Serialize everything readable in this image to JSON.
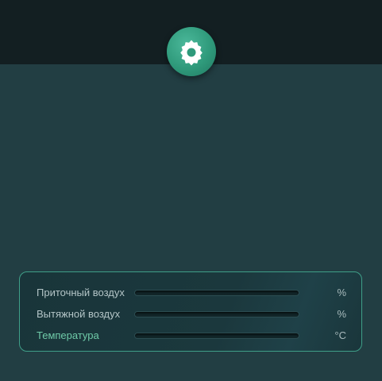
{
  "header": {
    "settings_icon": "gear-icon"
  },
  "panel": {
    "rows": [
      {
        "label": "Приточный воздух",
        "unit": "%",
        "level": 0
      },
      {
        "label": "Вытяжной воздух",
        "unit": "%",
        "level": 0
      },
      {
        "label": "Температура",
        "unit": "°C",
        "level": 0
      }
    ]
  },
  "colors": {
    "background": "#223e43",
    "top_bar": "#131f22",
    "accent": "#3f9f88",
    "label_text": "#b4c5c7",
    "accent_text": "#6fcaa8"
  }
}
